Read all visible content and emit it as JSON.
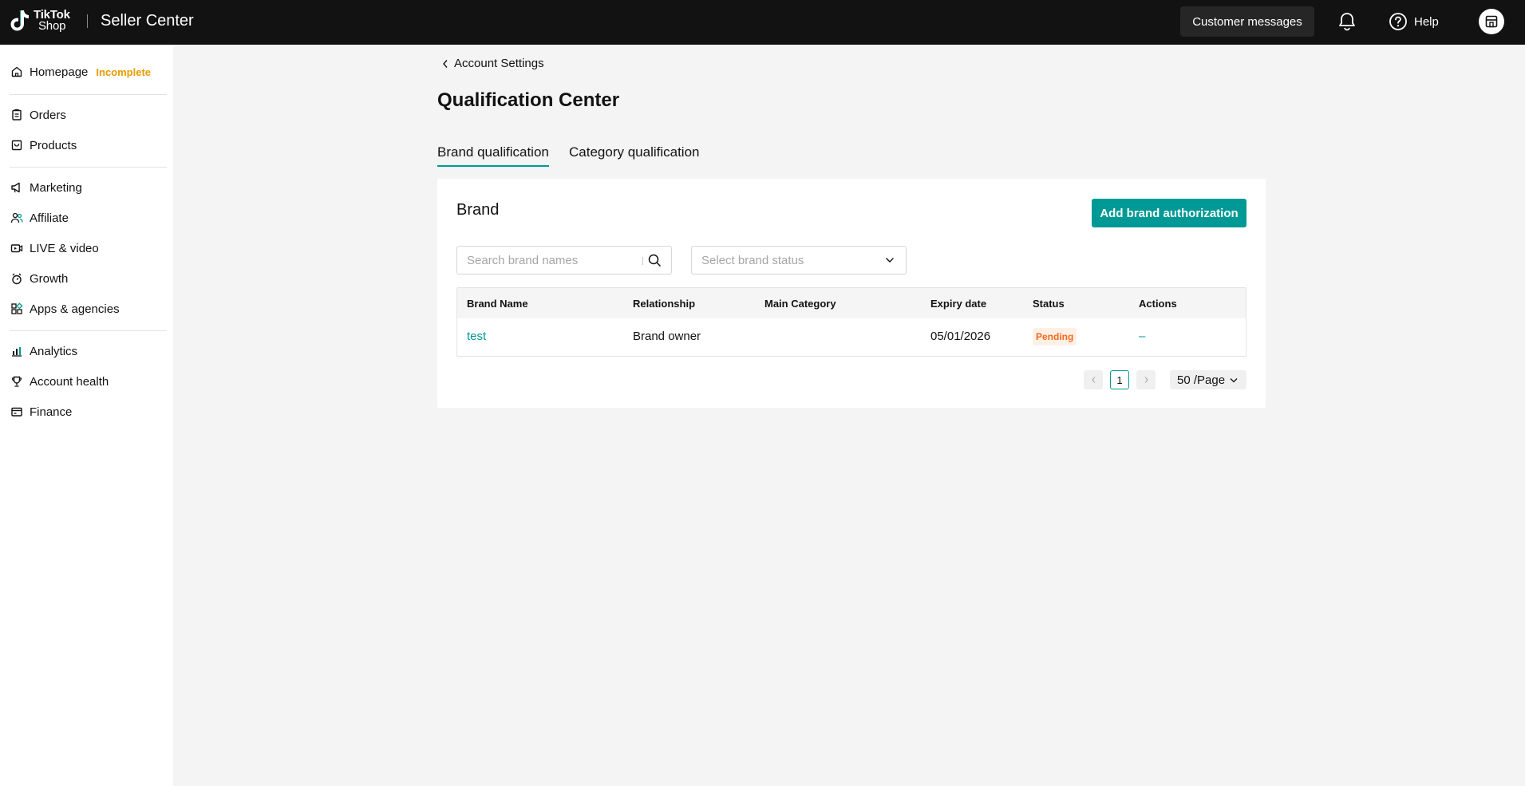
{
  "header": {
    "logo_line1": "TikTok",
    "logo_line2": "Shop",
    "app_title": "Seller Center",
    "customer_messages_label": "Customer messages",
    "help_label": "Help"
  },
  "sidebar": {
    "items": [
      {
        "label": "Homepage",
        "icon": "home-icon",
        "badge": "Incomplete"
      },
      {
        "label": "Orders",
        "icon": "clipboard-icon"
      },
      {
        "label": "Products",
        "icon": "bag-icon"
      },
      {
        "label": "Marketing",
        "icon": "megaphone-icon"
      },
      {
        "label": "Affiliate",
        "icon": "people-icon"
      },
      {
        "label": "LIVE & video",
        "icon": "video-icon"
      },
      {
        "label": "Growth",
        "icon": "growth-icon"
      },
      {
        "label": "Apps & agencies",
        "icon": "apps-icon"
      },
      {
        "label": "Analytics",
        "icon": "analytics-icon"
      },
      {
        "label": "Account health",
        "icon": "trophy-icon"
      },
      {
        "label": "Finance",
        "icon": "wallet-icon"
      }
    ]
  },
  "main": {
    "breadcrumb": "Account Settings",
    "title": "Qualification Center",
    "tabs": [
      {
        "label": "Brand qualification",
        "active": true
      },
      {
        "label": "Category qualification",
        "active": false
      }
    ],
    "card": {
      "title": "Brand",
      "add_button_label": "Add brand authorization",
      "search_placeholder": "Search brand names",
      "status_placeholder": "Select brand status",
      "columns": [
        "Brand Name",
        "Relationship",
        "Main Category",
        "Expiry date",
        "Status",
        "Actions"
      ],
      "rows": [
        {
          "brand_name": "test",
          "relationship": "Brand owner",
          "main_category": "",
          "expiry_date": "05/01/2026",
          "status": "Pending",
          "actions": "–"
        }
      ]
    },
    "pagination": {
      "current_page": "1",
      "page_size": "50 /Page"
    }
  },
  "colors": {
    "accent": "#009995",
    "topbar": "#121212",
    "incomplete": "#e69a00",
    "pending_text": "#f26a1b",
    "pending_bg": "#fff0e6"
  }
}
